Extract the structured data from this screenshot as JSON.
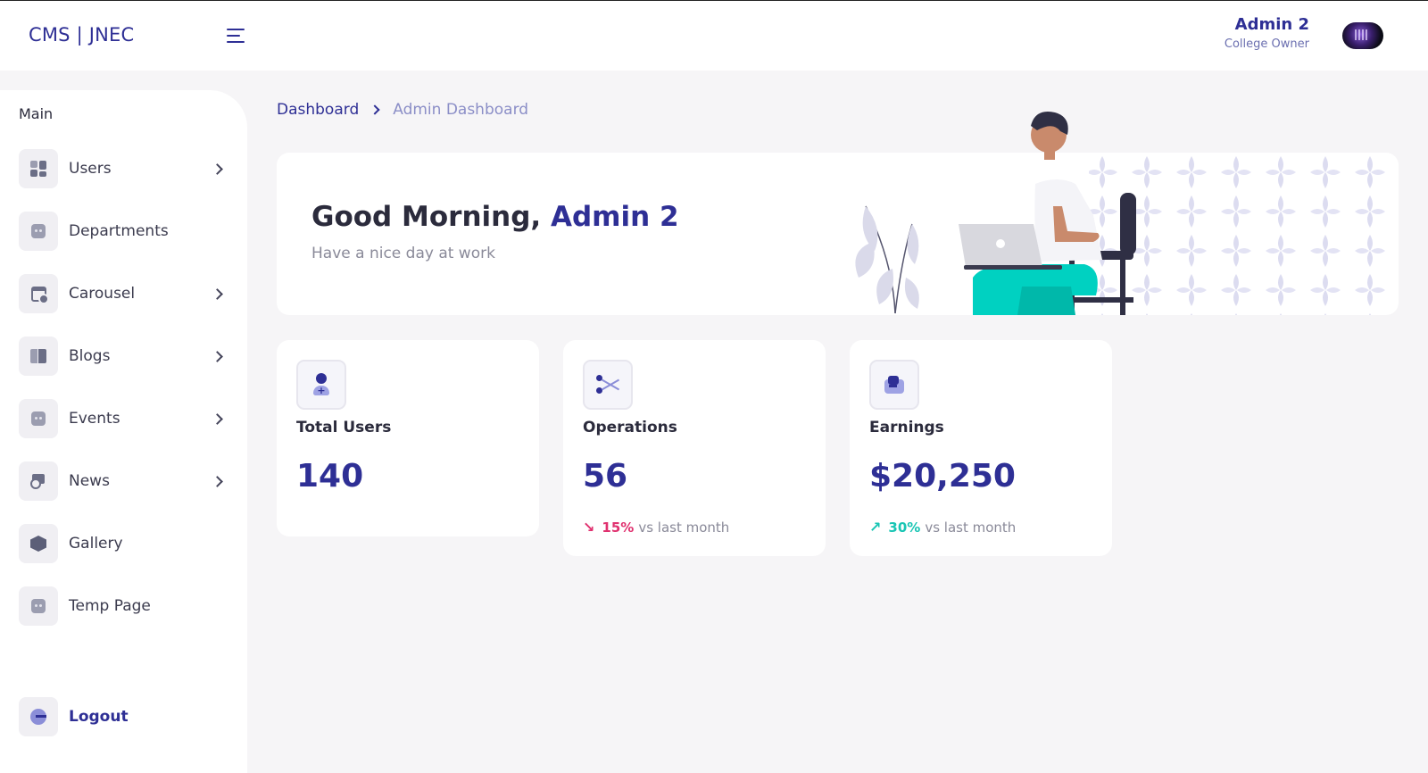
{
  "header": {
    "brand": "CMS | JNEC",
    "user_name": "Admin 2",
    "user_role": "College Owner"
  },
  "sidebar": {
    "heading": "Main",
    "items": [
      {
        "label": "Users",
        "icon": "grid-icon",
        "has_submenu": true
      },
      {
        "label": "Departments",
        "icon": "placeholder-icon",
        "has_submenu": false
      },
      {
        "label": "Carousel",
        "icon": "calendar-icon",
        "has_submenu": true
      },
      {
        "label": "Blogs",
        "icon": "book-icon",
        "has_submenu": true
      },
      {
        "label": "Events",
        "icon": "placeholder-icon",
        "has_submenu": true
      },
      {
        "label": "News",
        "icon": "news-icon",
        "has_submenu": true
      },
      {
        "label": "Gallery",
        "icon": "box-icon",
        "has_submenu": false
      },
      {
        "label": "Temp Page",
        "icon": "placeholder-icon",
        "has_submenu": false
      }
    ],
    "logout_label": "Logout"
  },
  "breadcrumb": {
    "parent": "Dashboard",
    "current": "Admin Dashboard"
  },
  "welcome": {
    "greeting": "Good Morning,",
    "name": "Admin 2",
    "subtitle": "Have a nice day at work"
  },
  "stats": [
    {
      "label": "Total Users",
      "value": "140",
      "icon": "user-add-icon"
    },
    {
      "label": "Operations",
      "value": "56",
      "icon": "operations-icon",
      "trend": {
        "direction": "down",
        "percent": "15%",
        "text": "vs last month"
      }
    },
    {
      "label": "Earnings",
      "value": "$20,250",
      "icon": "wallet-icon",
      "trend": {
        "direction": "up",
        "percent": "30%",
        "text": "vs last month"
      }
    }
  ],
  "colors": {
    "primary": "#2e2f95",
    "background": "#f6f5f7",
    "trend_down": "#e0316f",
    "trend_up": "#19c5b4",
    "illustration_pants": "#00d1c1"
  }
}
